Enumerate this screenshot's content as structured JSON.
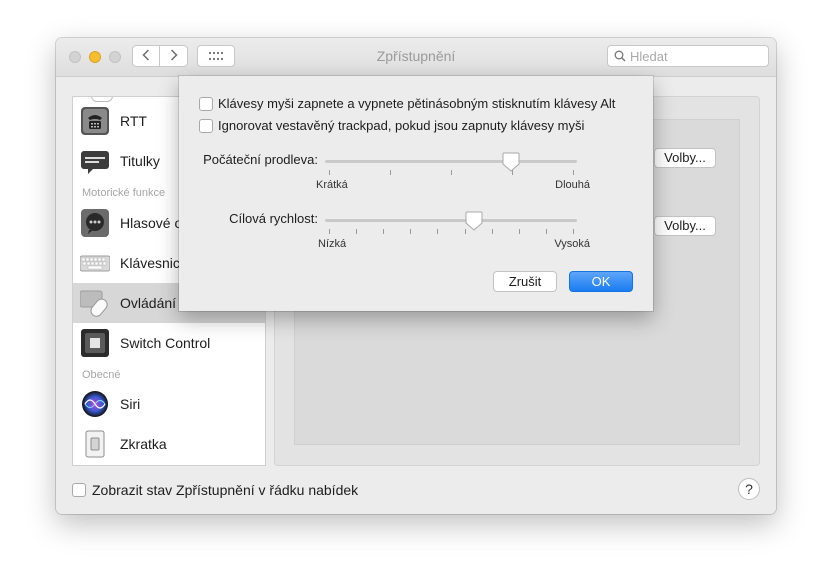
{
  "window": {
    "title": "Zpřístupnění"
  },
  "search": {
    "placeholder": "Hledat"
  },
  "sidebar": {
    "items": [
      {
        "label": "RTT",
        "icon": "phone-icon"
      },
      {
        "label": "Titulky",
        "icon": "captions-icon"
      },
      {
        "label": "Hlasové o",
        "icon": "voice-control-icon"
      },
      {
        "label": "Klávesnic",
        "icon": "keyboard-icon"
      },
      {
        "label": "Ovládání",
        "icon": "pointer-control-icon",
        "selected": true
      },
      {
        "label": "Switch Control",
        "icon": "switch-control-icon"
      },
      {
        "label": "Siri",
        "icon": "siri-icon"
      },
      {
        "label": "Zkratka",
        "icon": "shortcut-icon"
      }
    ],
    "sections": {
      "motor": "Motorické funkce",
      "general": "Obecné"
    }
  },
  "main": {
    "options_button_1": "Volby...",
    "options_button_2": "Volby..."
  },
  "footer": {
    "show_status_label": "Zobrazit stav Zpřístupnění v řádku nabídek",
    "show_status_checked": false,
    "help_label": "?"
  },
  "sheet": {
    "checkbox_1": {
      "label": "Klávesy myši zapnete a vypnete pětinásobným stisknutím klávesy Alt",
      "checked": false
    },
    "checkbox_2": {
      "label": "Ignorovat vestavěný trackpad, pokud jsou zapnuty klávesy myši",
      "checked": false
    },
    "initial_delay": {
      "label": "Počáteční prodleva:",
      "min_label": "Krátká",
      "max_label": "Dlouhá",
      "value": 0.74,
      "ticks": 5
    },
    "max_speed": {
      "label": "Cílová rychlost:",
      "min_label": "Nízká",
      "max_label": "Vysoká",
      "value": 0.59,
      "ticks": 10
    },
    "cancel_label": "Zrušit",
    "ok_label": "OK"
  },
  "colors": {
    "accent": "#1a7cf3",
    "window_bg": "#ececec",
    "traffic_yellow": "#f5bd2f"
  }
}
